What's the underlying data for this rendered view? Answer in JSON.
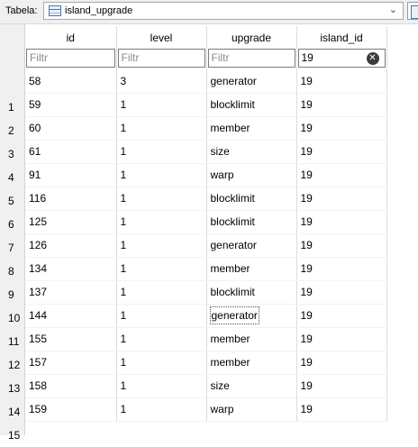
{
  "toolbar": {
    "label": "Tabela:",
    "table_name": "island_upgrade"
  },
  "columns": [
    "id",
    "level",
    "upgrade",
    "island_id"
  ],
  "filters": {
    "id": {
      "placeholder": "Filtr",
      "value": ""
    },
    "level": {
      "placeholder": "Filtr",
      "value": ""
    },
    "upgrade": {
      "placeholder": "Filtr",
      "value": ""
    },
    "island_id": {
      "placeholder": "Filtr",
      "value": "19"
    }
  },
  "row_numbers": [
    "1",
    "2",
    "3",
    "4",
    "5",
    "6",
    "7",
    "8",
    "9",
    "10",
    "11",
    "12",
    "13",
    "14",
    "15"
  ],
  "rows": [
    [
      "58",
      "3",
      "generator",
      "19"
    ],
    [
      "59",
      "1",
      "blocklimit",
      "19"
    ],
    [
      "60",
      "1",
      "member",
      "19"
    ],
    [
      "61",
      "1",
      "size",
      "19"
    ],
    [
      "91",
      "1",
      "warp",
      "19"
    ],
    [
      "116",
      "1",
      "blocklimit",
      "19"
    ],
    [
      "125",
      "1",
      "blocklimit",
      "19"
    ],
    [
      "126",
      "1",
      "generator",
      "19"
    ],
    [
      "134",
      "1",
      "member",
      "19"
    ],
    [
      "137",
      "1",
      "blocklimit",
      "19"
    ],
    [
      "144",
      "1",
      "generator",
      "19"
    ],
    [
      "155",
      "1",
      "member",
      "19"
    ],
    [
      "157",
      "1",
      "member",
      "19"
    ],
    [
      "158",
      "1",
      "size",
      "19"
    ],
    [
      "159",
      "1",
      "warp",
      "19"
    ]
  ],
  "focused_cell": {
    "row": 10,
    "col": 2
  },
  "icons": {
    "table": "table-icon",
    "dropdown": "chevron-down-icon",
    "clear": "clear-filter-icon"
  },
  "colors": {
    "toolbar_bg": "#f0f0f0",
    "grid_line": "#dcdcdc",
    "clear_icon": "#3c3c3c"
  }
}
